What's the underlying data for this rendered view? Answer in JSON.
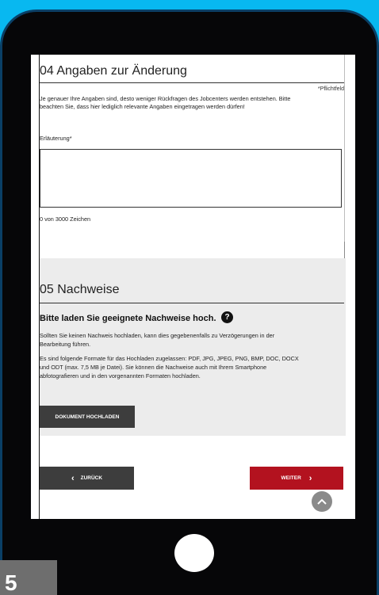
{
  "section4": {
    "title": "04 Angaben zur Änderung",
    "required_note": "*Pflichtfeld",
    "intro_line1": "Je genauer Ihre Angaben sind, desto weniger Rückfragen des Jobcenters werden entstehen. Bitte",
    "intro_line2": "beachten Sie, dass hier lediglich relevante Angaben eingetragen werden dürfen!",
    "field_label": "Erläuterung*",
    "field_value": "",
    "char_count": "0 von 3000 Zeichen"
  },
  "section5": {
    "title": "05 Nachweise",
    "heading": "Bitte laden Sie geeignete Nachweise hoch.",
    "help_icon": "?",
    "p1_line1": "Sollten Sie keinen Nachweis hochladen, kann dies gegebenenfalls zu Verzögerungen in der",
    "p1_line2": "Bearbeitung führen.",
    "p2_line1": "Es sind folgende Formate für das Hochladen zugelassen: PDF, JPG, JPEG, PNG, BMP, DOC, DOCX",
    "p2_line2": "und ODT (max. 7,5 MB je Datei). Sie können die Nachweise auch mit Ihrem Smartphone",
    "p2_line3": "abfotografieren und in den vorgenannten Formaten hochladen.",
    "upload_label": "DOKUMENT HOCHLADEN"
  },
  "nav": {
    "back_label": "ZURÜCK",
    "next_label": "WEITER",
    "back_icon": "chevron-left-icon",
    "next_icon": "chevron-right-icon",
    "top_icon": "chevron-up-icon"
  },
  "badge": {
    "text": "5"
  },
  "colors": {
    "background": "#08b8f0",
    "accent": "#b3121f",
    "button_dark": "#3d3d3d"
  }
}
